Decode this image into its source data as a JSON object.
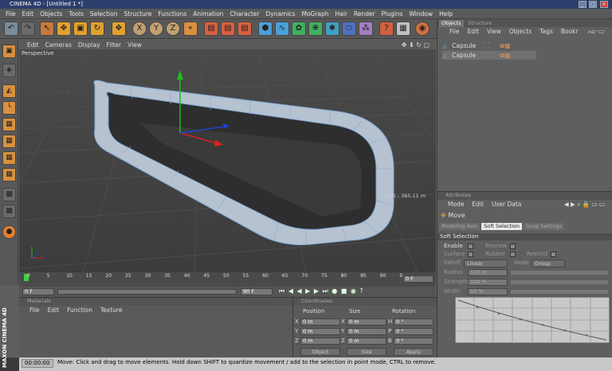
{
  "window": {
    "title": "CINEMA 4D - [Untitled 1 *]"
  },
  "menubar": [
    "File",
    "Edit",
    "Objects",
    "Tools",
    "Selection",
    "Structure",
    "Functions",
    "Animation",
    "Character",
    "Dynamics",
    "MoGraph",
    "Hair",
    "Render",
    "Plugins",
    "Window",
    "Help"
  ],
  "viewport": {
    "menu": [
      "Edit",
      "Cameras",
      "Display",
      "Filter",
      "View"
    ],
    "label": "Perspective",
    "distance": "Dist : 365.11 m"
  },
  "timeline": {
    "ticks": [
      "0",
      "5",
      "10",
      "15",
      "20",
      "25",
      "30",
      "35",
      "40",
      "45",
      "50",
      "55",
      "60",
      "65",
      "70",
      "75",
      "80",
      "85",
      "90",
      "9"
    ],
    "current_frame": "0 F",
    "start_frame": "0 F",
    "end_frame": "90 F"
  },
  "materials": {
    "header": "Materials",
    "menu": [
      "File",
      "Edit",
      "Function",
      "Texture"
    ]
  },
  "coordinates": {
    "header": "Coordinates",
    "col_headers": [
      "Position",
      "Size",
      "Rotation"
    ],
    "rows": [
      {
        "axis": "X",
        "pos": "0 m",
        "size_axis": "X",
        "size": "0 m",
        "rot_axis": "H",
        "rot": "0 °"
      },
      {
        "axis": "Y",
        "pos": "0 m",
        "size_axis": "Y",
        "size": "0 m",
        "rot_axis": "P",
        "rot": "0 °"
      },
      {
        "axis": "Z",
        "pos": "0 m",
        "size_axis": "Z",
        "size": "0 m",
        "rot_axis": "B",
        "rot": "0 °"
      }
    ],
    "mode_select": "Object",
    "size_select": "Size",
    "apply_label": "Apply"
  },
  "objects_panel": {
    "tabs": [
      "Objects",
      "Structure"
    ],
    "menu": [
      "File",
      "Edit",
      "View",
      "Objects",
      "Tags",
      "Bookr"
    ],
    "items": [
      "Capsule",
      "Capsule"
    ]
  },
  "attributes": {
    "header": "Attributes",
    "menu": [
      "Mode",
      "Edit",
      "User Data"
    ],
    "tool_name": "Move",
    "tabs": [
      "Modeling Axis",
      "Soft Selection",
      "Snap Settings"
    ],
    "section": "Soft Selection",
    "enable_label": "Enable",
    "preview_label": "Preview",
    "surface_label": "Surface",
    "rubber_label": "Rubber",
    "restrict_label": "Restrict",
    "falloff_label": "Falloff",
    "falloff_value": "Linear",
    "mode_label": "Mode",
    "mode_value": "Group",
    "radius_label": "Radius",
    "radius_value": "100 m",
    "strength_label": "Strength",
    "strength_value": "100 %",
    "width_label": "Width",
    "width_value": "50 %"
  },
  "status": {
    "time": "00:00:00",
    "message": "Move: Click and drag to move elements. Hold down SHIFT to quantize movement / add to the selection in point mode, CTRL to remove."
  },
  "brand": "MAXON CINEMA 4D",
  "colors": {
    "title_bar": "#2c3e6b",
    "selection_blue": "#7fa8d8",
    "axis_y": "#1fbf1f",
    "axis_x": "#d82020",
    "axis_z": "#2040d0"
  }
}
